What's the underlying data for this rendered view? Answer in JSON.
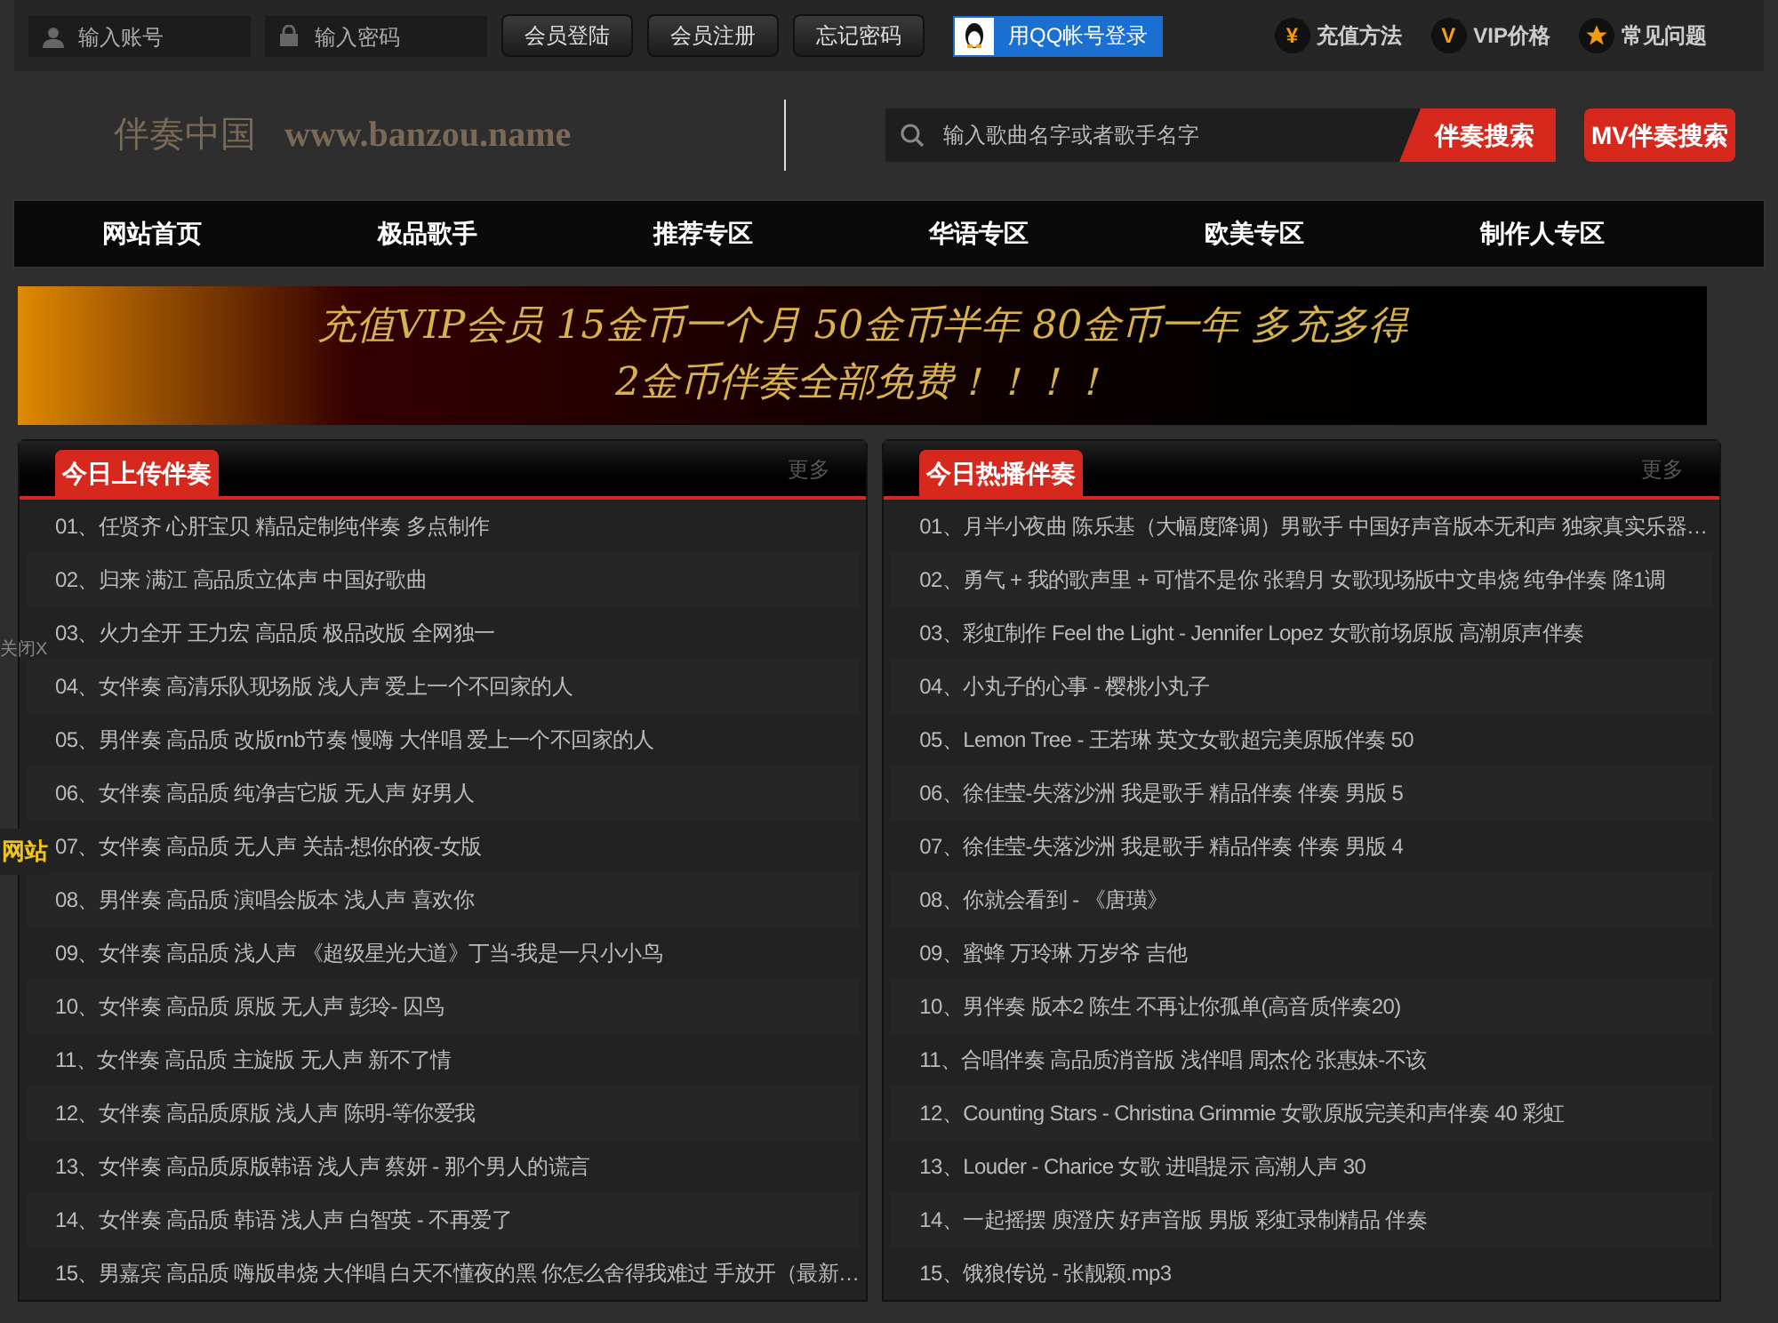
{
  "top_bar": {
    "account_field": {
      "placeholder": "输入账号"
    },
    "password_field": {
      "placeholder": "输入密码"
    },
    "buttons": [
      "会员登陆",
      "会员注册",
      "忘记密码"
    ],
    "qq_login": "用QQ帐号登录",
    "links": [
      {
        "kind": "yen",
        "icon": "¥",
        "label": "充值方法"
      },
      {
        "kind": "vip",
        "icon": "V",
        "label": "VIP价格"
      },
      {
        "kind": "star",
        "label": "常见问题"
      }
    ]
  },
  "header": {
    "logo_title": "伴奏中国",
    "logo_url": "www.banzou.name",
    "search": {
      "placeholder": "输入歌曲名字或者歌手名字",
      "button": "伴奏搜索"
    },
    "mv_button": "MV伴奏搜索"
  },
  "nav": [
    "网站首页",
    "极品歌手",
    "推荐专区",
    "华语专区",
    "欧美专区",
    "制作人专区"
  ],
  "banner": {
    "line_1": "充值VIP会员 15金币一个月 50金币半年 80金币一年 多充多得",
    "line_2": "2金币伴奏全部免费！！！！"
  },
  "panels": [
    {
      "title": "今日上传伴奏",
      "more": "更多",
      "items": [
        {
          "number": "01、",
          "title": "任贤齐 心肝宝贝 精品定制纯伴奏 多点制作"
        },
        {
          "number": "02、",
          "title": "归来 满江 高品质立体声 中国好歌曲"
        },
        {
          "number": "03、",
          "title": "火力全开 王力宏 高品质 极品改版 全网独一"
        },
        {
          "number": "04、",
          "title": "女伴奏 高清乐队现场版 浅人声 爱上一个不回家的人"
        },
        {
          "number": "05、",
          "title": "男伴奏 高品质 改版rnb节奏 慢嗨 大伴唱 爱上一个不回家的人"
        },
        {
          "number": "06、",
          "title": "女伴奏 高品质 纯净吉它版 无人声 好男人"
        },
        {
          "number": "07、",
          "title": "女伴奏 高品质 无人声 关喆-想你的夜-女版"
        },
        {
          "number": "08、",
          "title": "男伴奏 高品质 演唱会版本 浅人声 喜欢你"
        },
        {
          "number": "09、",
          "title": "女伴奏 高品质 浅人声 《超级星光大道》丁当-我是一只小小鸟"
        },
        {
          "number": "10、",
          "title": "女伴奏 高品质 原版 无人声 彭玲- 囚鸟"
        },
        {
          "number": "11、",
          "title": "女伴奏 高品质 主旋版 无人声 新不了情"
        },
        {
          "number": "12、",
          "title": "女伴奏 高品质原版 浅人声 陈明-等你爱我"
        },
        {
          "number": "13、",
          "title": "女伴奏 高品质原版韩语 浅人声 蔡妍 - 那个男人的谎言"
        },
        {
          "number": "14、",
          "title": "女伴奏 高品质 韩语 浅人声 白智英 - 不再爱了"
        },
        {
          "number": "15、",
          "title": "男嘉宾 高品质 嗨版串烧 大伴唱 白天不懂夜的黑 你怎么舍得我难过 手放开（最新…"
        }
      ]
    },
    {
      "title": "今日热播伴奏",
      "more": "更多",
      "items": [
        {
          "number": "01、",
          "title": "月半小夜曲 陈乐基（大幅度降调）男歌手 中国好声音版本无和声 独家真实乐器…"
        },
        {
          "number": "02、",
          "title": "勇气 + 我的歌声里 + 可惜不是你 张碧月 女歌现场版中文串烧 纯争伴奏 降1调"
        },
        {
          "number": "03、",
          "title": "彩虹制作 Feel the Light - Jennifer Lopez 女歌前场原版 高潮原声伴奏"
        },
        {
          "number": "04、",
          "title": "小丸子的心事 - 樱桃小丸子"
        },
        {
          "number": "05、",
          "title": "Lemon Tree - 王若琳 英文女歌超完美原版伴奏 50"
        },
        {
          "number": "06、",
          "title": "徐佳莹-失落沙洲 我是歌手 精品伴奏 伴奏 男版 5"
        },
        {
          "number": "07、",
          "title": "徐佳莹-失落沙洲 我是歌手 精品伴奏 伴奏 男版 4"
        },
        {
          "number": "08、",
          "title": "你就会看到 - 《唐璜》"
        },
        {
          "number": "09、",
          "title": "蜜蜂 万玲琳 万岁爷 吉他"
        },
        {
          "number": "10、",
          "title": "男伴奏 版本2 陈生 不再让你孤单(高音质伴奏20)"
        },
        {
          "number": "11、",
          "title": "合唱伴奏 高品质消音版 浅伴唱 周杰伦 张惠妹-不该"
        },
        {
          "number": "12、",
          "title": "Counting Stars - Christina Grimmie 女歌原版完美和声伴奏 40 彩虹"
        },
        {
          "number": "13、",
          "title": "Louder - Charice 女歌 进唱提示 高潮人声 30"
        },
        {
          "number": "14、",
          "title": "一起摇摆 庾澄庆 好声音版 男版 彩虹录制精品 伴奏"
        },
        {
          "number": "15、",
          "title": "饿狼传说 - 张靓颖.mp3"
        }
      ]
    }
  ],
  "floating": {
    "close": "关闭X",
    "badge": "网站"
  }
}
